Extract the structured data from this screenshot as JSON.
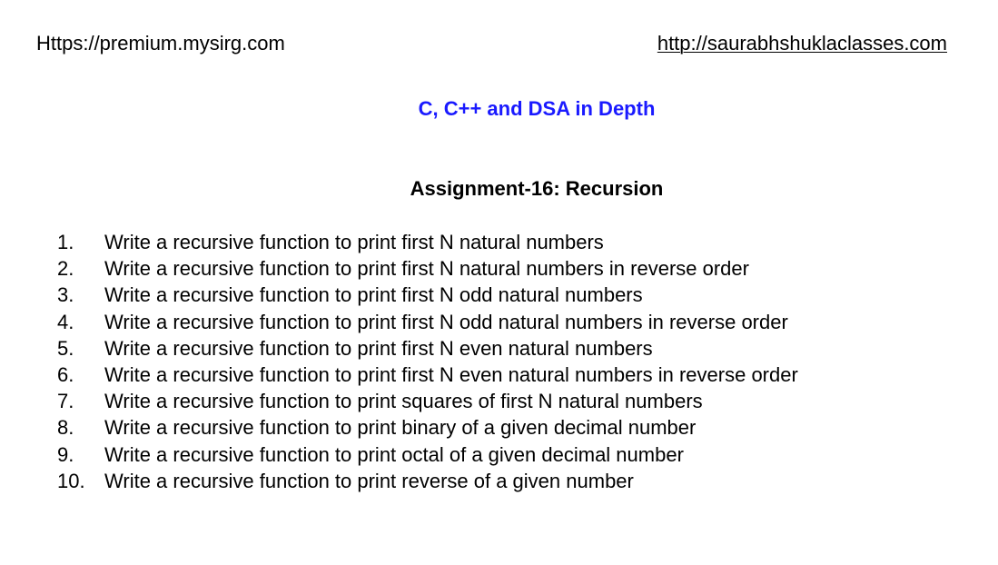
{
  "header": {
    "left_link": "Https://premium.mysirg.com",
    "right_link": "http://saurabhshuklaclasses.com"
  },
  "course_title": "C, C++ and DSA in Depth",
  "assignment_title": "Assignment-16: Recursion",
  "colors": {
    "course_title": "#1a1aff",
    "text": "#000000"
  },
  "questions": [
    {
      "num": "1.",
      "text": "Write a recursive function to print first N natural numbers"
    },
    {
      "num": "2.",
      "text": "Write a recursive function to print first N natural numbers in reverse order"
    },
    {
      "num": "3.",
      "text": "Write a recursive function to print first N odd natural numbers"
    },
    {
      "num": "4.",
      "text": "Write a recursive function to print first N odd natural numbers in reverse order"
    },
    {
      "num": "5.",
      "text": "Write a recursive function to print first N even natural numbers"
    },
    {
      "num": "6.",
      "text": "Write a recursive function to print first N even natural numbers in reverse order"
    },
    {
      "num": "7.",
      "text": "Write a recursive function to print squares of first N natural numbers"
    },
    {
      "num": "8.",
      "text": "Write a recursive function to print binary of a given decimal number"
    },
    {
      "num": "9.",
      "text": "Write a recursive function to print octal of a given decimal number"
    },
    {
      "num": "10.",
      "text": "Write a recursive function to print reverse of a given number"
    }
  ]
}
